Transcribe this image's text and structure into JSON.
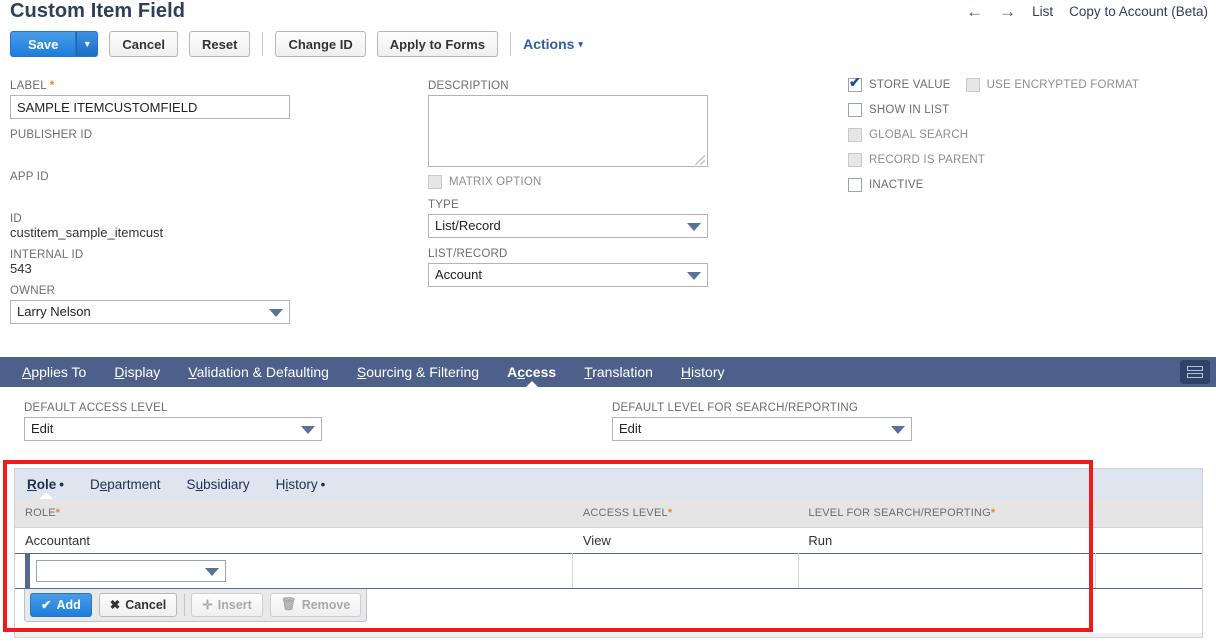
{
  "header": {
    "title": "Custom Item Field",
    "nav": {
      "back_icon": "arrow-left-icon",
      "forward_icon": "arrow-right-icon",
      "list_label": "List",
      "copy_label": "Copy to Account (Beta)"
    }
  },
  "toolbar": {
    "save_label": "Save",
    "save_caret": "▼",
    "cancel_label": "Cancel",
    "reset_label": "Reset",
    "change_id_label": "Change ID",
    "apply_to_forms_label": "Apply to Forms",
    "actions_label": "Actions",
    "actions_caret": "▾"
  },
  "form": {
    "label_field": {
      "label": "LABEL",
      "required": "*",
      "value": "SAMPLE ITEMCUSTOMFIELD"
    },
    "publisher_id": {
      "label": "PUBLISHER ID",
      "value": ""
    },
    "app_id": {
      "label": "APP ID",
      "value": ""
    },
    "id": {
      "label": "ID",
      "value": "custitem_sample_itemcust"
    },
    "internal_id": {
      "label": "INTERNAL ID",
      "value": "543"
    },
    "owner": {
      "label": "OWNER",
      "value": "Larry Nelson"
    },
    "description": {
      "label": "DESCRIPTION",
      "value": ""
    },
    "matrix_option": {
      "label": "MATRIX OPTION",
      "checked": false,
      "disabled": true
    },
    "type": {
      "label": "TYPE",
      "value": "List/Record"
    },
    "list_record": {
      "label": "LIST/RECORD",
      "value": "Account"
    }
  },
  "checkboxes": [
    {
      "label": "STORE VALUE",
      "checked": true,
      "disabled": false
    },
    {
      "label": "USE ENCRYPTED FORMAT",
      "checked": false,
      "disabled": true
    },
    {
      "label": "SHOW IN LIST",
      "checked": false,
      "disabled": false
    },
    {
      "label": "GLOBAL SEARCH",
      "checked": false,
      "disabled": true
    },
    {
      "label": "RECORD IS PARENT",
      "checked": false,
      "disabled": true
    },
    {
      "label": "INACTIVE",
      "checked": false,
      "disabled": false
    }
  ],
  "tabs": [
    {
      "mnemonic": "A",
      "rest": "pplies To",
      "active": false
    },
    {
      "mnemonic": "D",
      "rest": "isplay",
      "active": false
    },
    {
      "mnemonic": "V",
      "rest": "alidation & Defaulting",
      "active": false
    },
    {
      "mnemonic": "S",
      "rest": "ourcing & Filtering",
      "active": false
    },
    {
      "pre": "A",
      "mnemonic": "c",
      "rest": "cess",
      "active": true
    },
    {
      "mnemonic": "T",
      "rest": "ranslation",
      "active": false
    },
    {
      "mnemonic": "H",
      "rest": "istory",
      "active": false
    }
  ],
  "tabbar_icon": "layout-split-icon",
  "access": {
    "default_access_level": {
      "label": "DEFAULT ACCESS LEVEL",
      "value": "Edit"
    },
    "default_search_level": {
      "label": "DEFAULT LEVEL FOR SEARCH/REPORTING",
      "value": "Edit"
    }
  },
  "sublist": {
    "tabs": [
      {
        "mnemonic": "R",
        "rest": "ole",
        "dot": "•",
        "active": true
      },
      {
        "pre": "D",
        "mnemonic": "e",
        "rest": "partment",
        "dot": "",
        "active": false
      },
      {
        "pre": "S",
        "mnemonic": "u",
        "rest": "bsidiary",
        "dot": "",
        "active": false
      },
      {
        "pre": "H",
        "mnemonic": "i",
        "rest": "story",
        "dot": "•",
        "active": false
      }
    ],
    "columns": [
      {
        "label": "ROLE",
        "required": "*"
      },
      {
        "label": "ACCESS LEVEL",
        "required": "*"
      },
      {
        "label": "LEVEL FOR SEARCH/REPORTING",
        "required": "*"
      },
      {
        "label": "",
        "required": ""
      }
    ],
    "rows": [
      {
        "role": "Accountant",
        "access_level": "View",
        "search_level": "Run"
      }
    ],
    "edit_row": {
      "role": "",
      "access_level": "",
      "search_level": ""
    },
    "buttons": {
      "add": {
        "icon": "check-icon",
        "glyph": "✔",
        "label": "Add",
        "disabled": false
      },
      "cancel": {
        "icon": "x-icon",
        "glyph": "✖",
        "label": "Cancel",
        "disabled": false
      },
      "insert": {
        "icon": "plus-icon",
        "glyph": "✛",
        "label": "Insert",
        "disabled": true
      },
      "remove": {
        "icon": "trash-icon",
        "glyph": "🗑",
        "label": "Remove",
        "disabled": true
      }
    }
  },
  "annotation": {
    "type": "red-highlight-rectangle",
    "color": "#ef1b1b"
  },
  "colors": {
    "title": "#2e3f5c",
    "primary_button": "#1d7ddc",
    "tabbar": "#4d6089",
    "required_star": "#e38b1b",
    "sublist_tabstrip": "#dfe5ef"
  }
}
